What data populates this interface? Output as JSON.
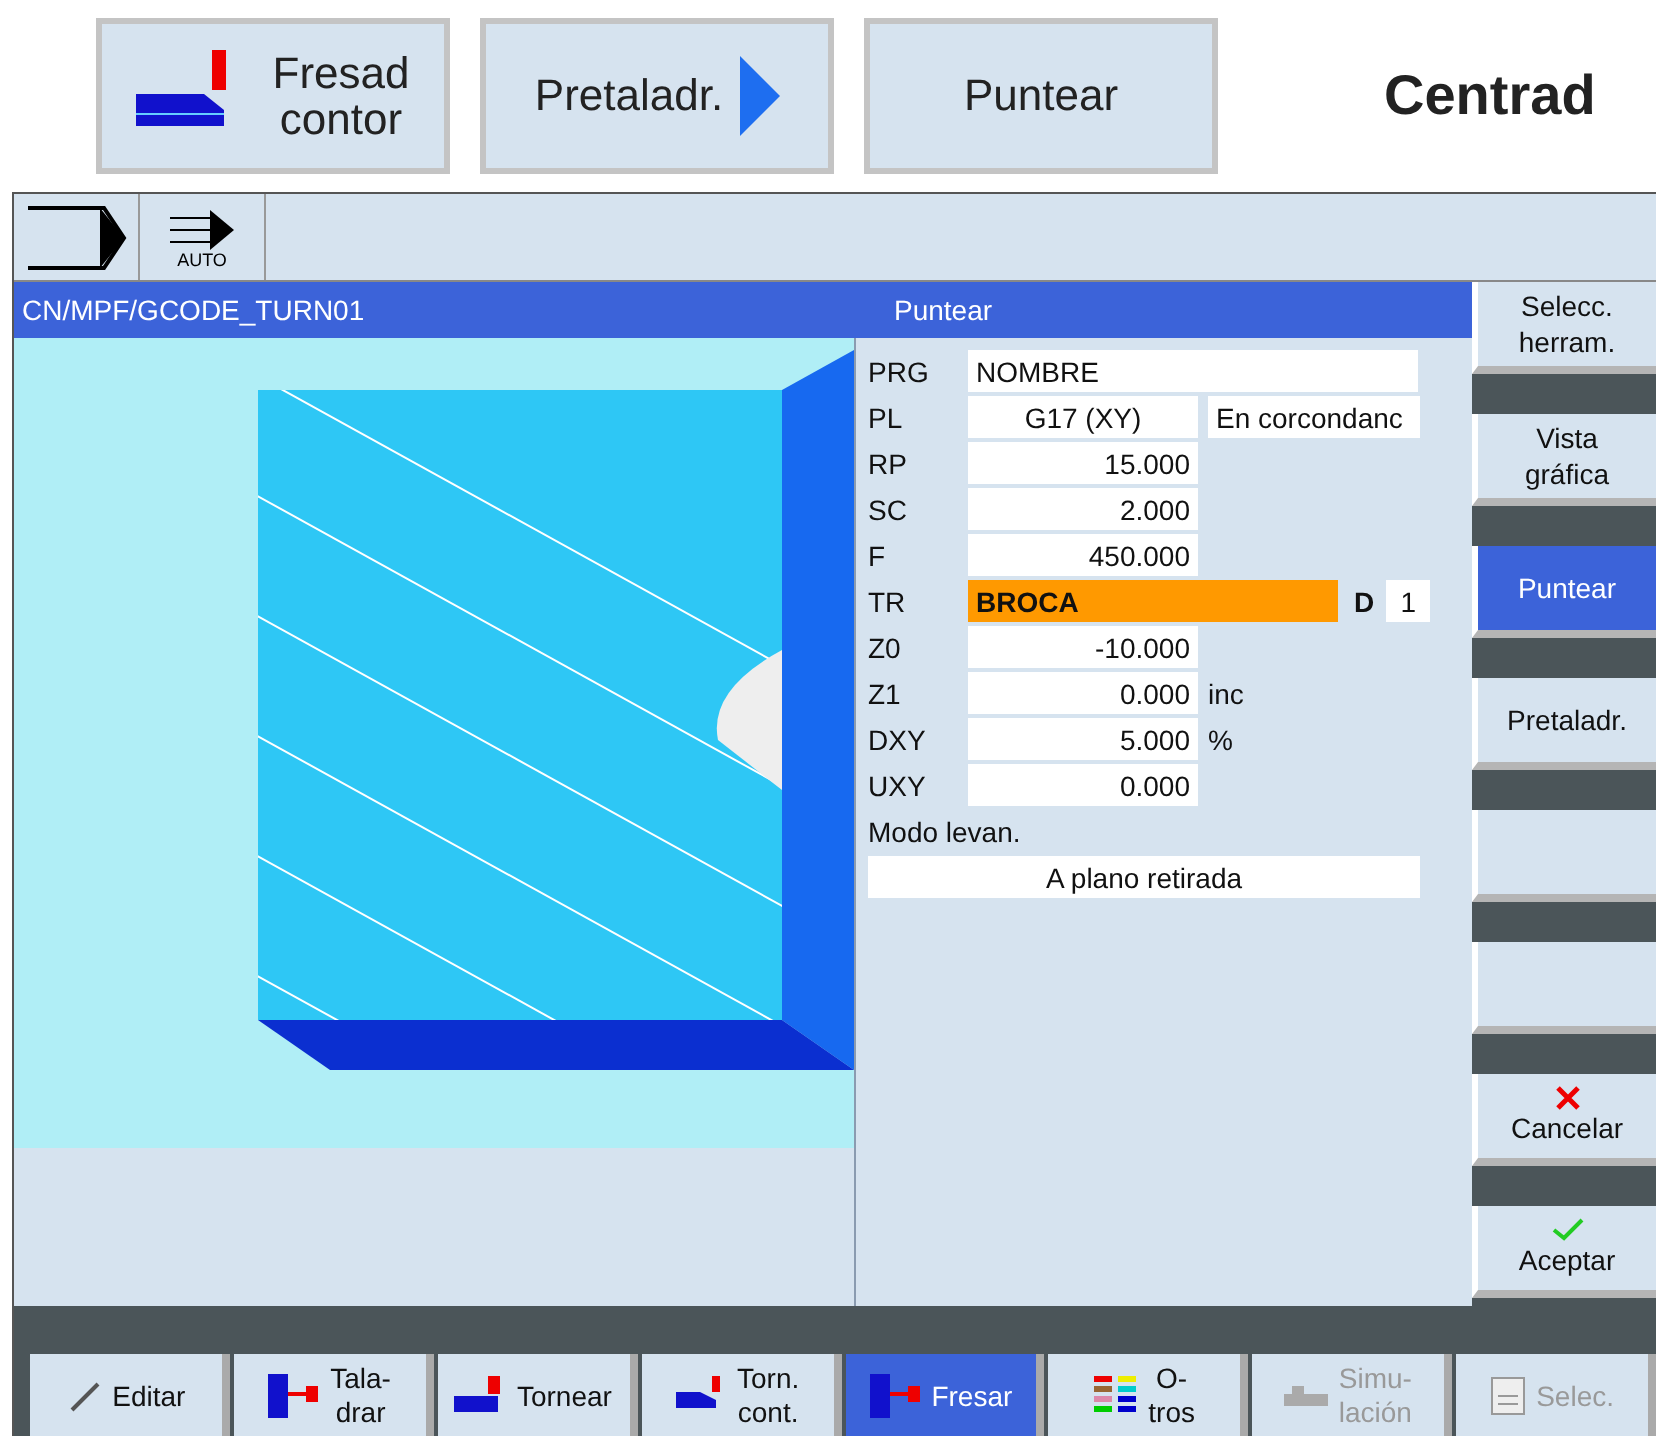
{
  "top_buttons": [
    {
      "label": "Fresad\ncontor",
      "kind": "contour"
    },
    {
      "label": "Pretaladr.",
      "kind": "arrow"
    },
    {
      "label": "Puntear",
      "kind": "plain"
    }
  ],
  "heading": "Centrad",
  "toolbar": {
    "mode_label": "AUTO"
  },
  "title_bar": {
    "path": "CN/MPF/GCODE_TURN01",
    "title": "Puntear"
  },
  "params": [
    {
      "label": "PRG",
      "kind": "wide",
      "value": "NOMBRE"
    },
    {
      "label": "PL",
      "kind": "center",
      "value": "G17 (XY)",
      "extra": "En corcondanc"
    },
    {
      "label": "RP",
      "kind": "number",
      "value": "15.000"
    },
    {
      "label": "SC",
      "kind": "number",
      "value": "2.000"
    },
    {
      "label": "F",
      "kind": "number",
      "value": "450.000"
    },
    {
      "label": "TR",
      "kind": "tool",
      "value": "BROCA",
      "d_label": "D",
      "d_value": "1"
    },
    {
      "label": "Z0",
      "kind": "number",
      "value": "-10.000"
    },
    {
      "label": "Z1",
      "kind": "number",
      "value": "0.000",
      "unit": "inc"
    },
    {
      "label": "DXY",
      "kind": "number",
      "value": "5.000",
      "unit": "%"
    },
    {
      "label": "UXY",
      "kind": "number",
      "value": "0.000"
    },
    {
      "label": "Modo levan.",
      "kind": "heading"
    },
    {
      "label": "A plano retirada",
      "kind": "full"
    }
  ],
  "softkeys": [
    {
      "label": "Selecc.\nherram.",
      "selected": false,
      "kind": "text"
    },
    {
      "label": "Vista\ngráfica",
      "selected": false,
      "kind": "text"
    },
    {
      "label": "Puntear",
      "selected": true,
      "kind": "text"
    },
    {
      "label": "Pretaladr.",
      "selected": false,
      "kind": "text"
    },
    {
      "selected": false,
      "kind": "empty"
    },
    {
      "selected": false,
      "kind": "empty"
    },
    {
      "label": "Cancelar",
      "selected": false,
      "kind": "cancel"
    },
    {
      "label": "Aceptar",
      "selected": false,
      "kind": "accept"
    }
  ],
  "bottom_tabs": [
    {
      "label": "Editar",
      "selected": false,
      "disabled": false
    },
    {
      "label": "Tala-\ndrar",
      "selected": false,
      "disabled": false
    },
    {
      "label": "Tornear",
      "selected": false,
      "disabled": false
    },
    {
      "label": "Torn.\ncont.",
      "selected": false,
      "disabled": false
    },
    {
      "label": "Fresar",
      "selected": true,
      "disabled": false
    },
    {
      "label": "O-\ntros",
      "selected": false,
      "disabled": false
    },
    {
      "label": "Simu-\nlación",
      "selected": false,
      "disabled": true
    },
    {
      "label": "Selec.",
      "selected": false,
      "disabled": true
    }
  ]
}
